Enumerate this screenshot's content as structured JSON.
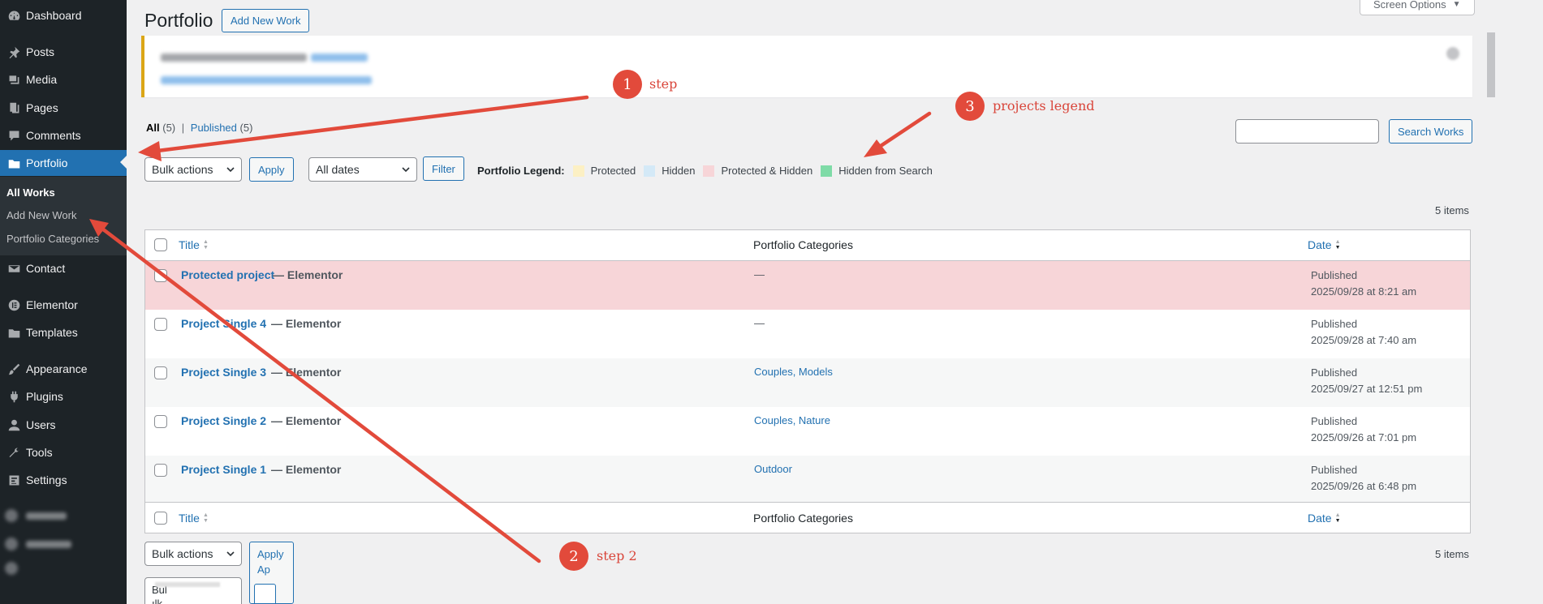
{
  "sidebar": {
    "items": [
      {
        "label": "Dashboard",
        "icon": "dashboard-icon"
      },
      {
        "label": "Posts",
        "icon": "pin-icon"
      },
      {
        "label": "Media",
        "icon": "media-icon"
      },
      {
        "label": "Pages",
        "icon": "pages-icon"
      },
      {
        "label": "Comments",
        "icon": "comments-icon"
      },
      {
        "label": "Portfolio",
        "icon": "portfolio-icon",
        "current": true
      },
      {
        "label": "Contact",
        "icon": "mail-icon"
      },
      {
        "label": "Elementor",
        "icon": "elementor-icon"
      },
      {
        "label": "Templates",
        "icon": "folder-icon"
      },
      {
        "label": "Appearance",
        "icon": "brush-icon"
      },
      {
        "label": "Plugins",
        "icon": "plugin-icon"
      },
      {
        "label": "Users",
        "icon": "user-icon"
      },
      {
        "label": "Tools",
        "icon": "wrench-icon"
      },
      {
        "label": "Settings",
        "icon": "settings-icon"
      }
    ],
    "submenu": [
      {
        "label": "All Works",
        "current": true
      },
      {
        "label": "Add New Work"
      },
      {
        "label": "Portfolio Categories"
      }
    ]
  },
  "header": {
    "title": "Portfolio",
    "add_new": "Add New Work",
    "screen_options": "Screen Options"
  },
  "views": {
    "all": "All",
    "all_count": "(5)",
    "separator": "|",
    "published": "Published",
    "published_count": "(5)"
  },
  "search": {
    "value": "",
    "button": "Search Works"
  },
  "toolbar": {
    "bulk_actions": "Bulk actions",
    "apply": "Apply",
    "dates": "All dates",
    "filter": "Filter"
  },
  "legend": {
    "title": "Portfolio Legend:",
    "items": [
      {
        "label": "Protected",
        "color": "#fcf0c4"
      },
      {
        "label": "Hidden",
        "color": "#d4e9f7"
      },
      {
        "label": "Protected & Hidden",
        "color": "#f7d5d8"
      },
      {
        "label": "Hidden from Search",
        "color": "#7fdba7"
      }
    ]
  },
  "items_count": "5 items",
  "table": {
    "columns": {
      "title": "Title",
      "categories": "Portfolio Categories",
      "date": "Date"
    },
    "rows": [
      {
        "title": "Protected project",
        "state": "— Elementor",
        "categories": "—",
        "status": "Published",
        "date": "2025/09/28 at 8:21 am",
        "highlight": "#f7d5d8"
      },
      {
        "title": "Project Single 4",
        "state": "— Elementor",
        "categories": "—",
        "status": "Published",
        "date": "2025/09/28 at 7:40 am",
        "highlight": "#ffffff"
      },
      {
        "title": "Project Single 3",
        "state": "— Elementor",
        "categories": "Couples, Models",
        "status": "Published",
        "date": "2025/09/27 at 12:51 pm",
        "highlight": "#f6f7f7"
      },
      {
        "title": "Project Single 2",
        "state": "— Elementor",
        "categories": "Couples, Nature",
        "status": "Published",
        "date": "2025/09/26 at 7:01 pm",
        "highlight": "#ffffff"
      },
      {
        "title": "Project Single 1",
        "state": "— Elementor",
        "categories": "Outdoor",
        "status": "Published",
        "date": "2025/09/26 at 6:48 pm",
        "highlight": "#f6f7f7"
      }
    ]
  },
  "bottom": {
    "bulk_actions": "Bulk actions",
    "apply": "Apply",
    "apply_overflow": "Ap",
    "dropdown_fragment": "Bul",
    "dropdown_fragment2": "ılk"
  },
  "annotations": [
    {
      "number": "1",
      "label": "step"
    },
    {
      "number": "2",
      "label": "step 2"
    },
    {
      "number": "3",
      "label": "projects legend"
    }
  ],
  "colors": {
    "accent": "#2271b1",
    "sidebar_bg": "#1d2327",
    "annotation": "#e24a3b"
  }
}
